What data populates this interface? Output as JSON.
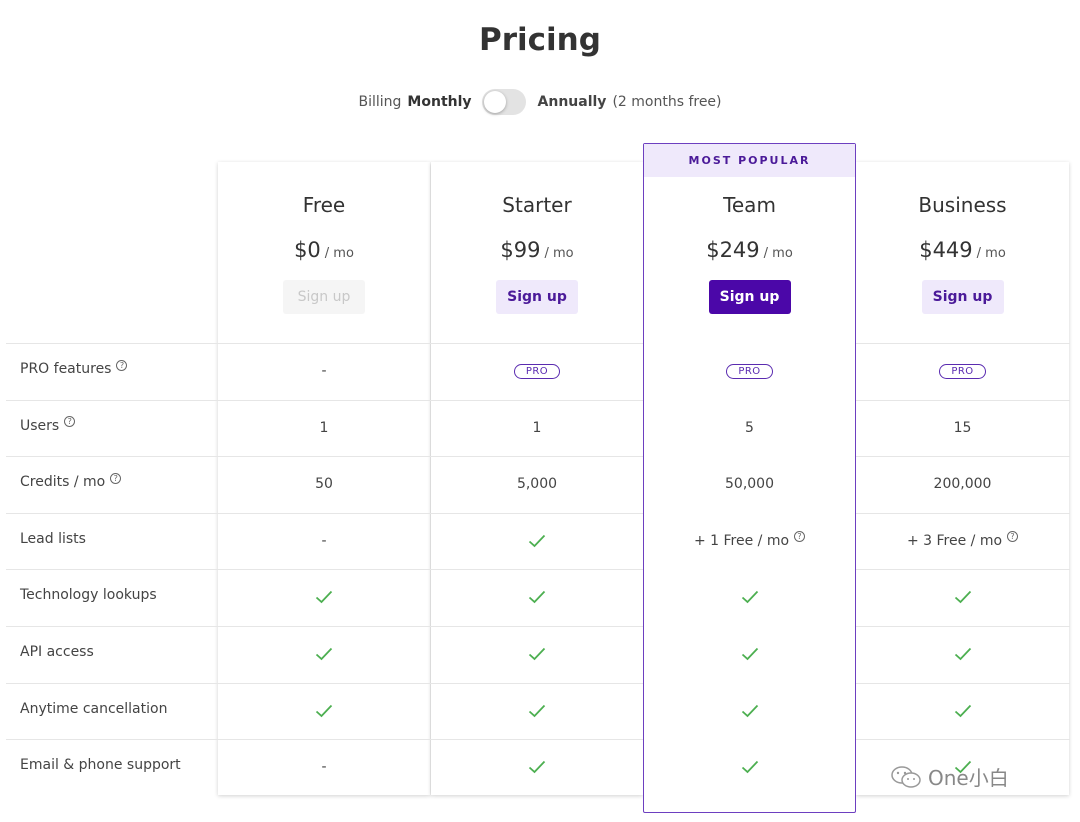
{
  "header": {
    "title": "Pricing"
  },
  "billing": {
    "label": "Billing",
    "monthly": "Monthly",
    "annually": "Annually",
    "annual_note": "(2 months free)",
    "annual_selected": false
  },
  "badge": "MOST POPULAR",
  "per": "/ mo",
  "plans": [
    {
      "name": "Free",
      "price": "$0",
      "button": "Sign up"
    },
    {
      "name": "Starter",
      "price": "$99",
      "button": "Sign up"
    },
    {
      "name": "Team",
      "price": "$249",
      "button": "Sign up"
    },
    {
      "name": "Business",
      "price": "$449",
      "button": "Sign up"
    }
  ],
  "features": [
    {
      "label": "PRO features",
      "help": true,
      "values": [
        "-",
        "PRO",
        "PRO",
        "PRO"
      ]
    },
    {
      "label": "Users",
      "help": true,
      "values": [
        "1",
        "1",
        "5",
        "15"
      ]
    },
    {
      "label": "Credits / mo",
      "help": true,
      "values": [
        "50",
        "5,000",
        "50,000",
        "200,000"
      ]
    },
    {
      "label": "Lead lists",
      "help": false,
      "values": [
        "-",
        "check",
        "+ 1 Free / mo",
        "+ 3 Free / mo"
      ]
    },
    {
      "label": "Technology lookups",
      "help": false,
      "values": [
        "check",
        "check",
        "check",
        "check"
      ]
    },
    {
      "label": "API access",
      "help": false,
      "values": [
        "check",
        "check",
        "check",
        "check"
      ]
    },
    {
      "label": "Anytime cancellation",
      "help": false,
      "values": [
        "check",
        "check",
        "check",
        "check"
      ]
    },
    {
      "label": "Email & phone support",
      "help": false,
      "values": [
        "-",
        "check",
        "check",
        "check"
      ]
    }
  ],
  "help_rows": {
    "Lead lists": [
      2,
      3
    ]
  },
  "watermark": "One小白",
  "colors": {
    "accent": "#4b07a8",
    "accent_light": "#efe9fb",
    "check": "#4caf50",
    "border": "#6d3fc0"
  },
  "icons": {
    "help": "help-circle-icon",
    "check": "check-icon"
  }
}
